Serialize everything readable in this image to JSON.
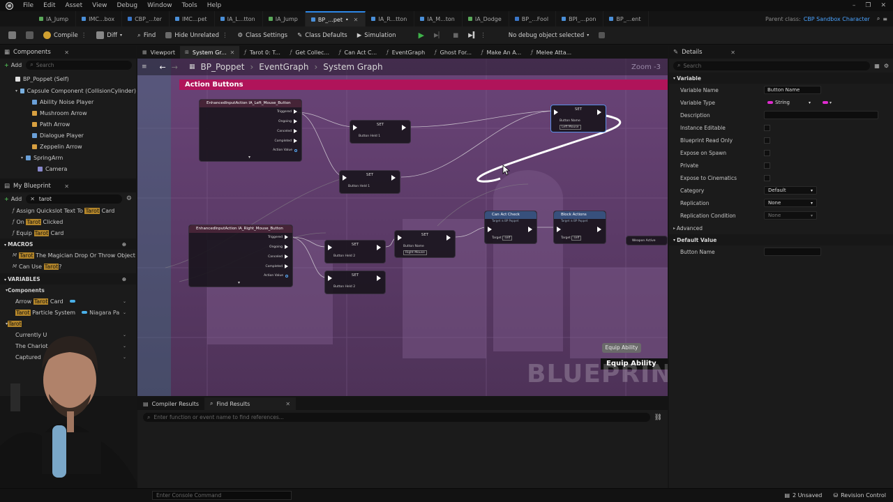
{
  "menu": [
    "File",
    "Edit",
    "Asset",
    "View",
    "Debug",
    "Window",
    "Tools",
    "Help"
  ],
  "tabs": [
    {
      "label": "IA_Jump"
    },
    {
      "label": "IMC...box"
    },
    {
      "label": "CBP_...ter"
    },
    {
      "label": "IMC...pet"
    },
    {
      "label": "IA_L...tton"
    },
    {
      "label": "IA_Jump"
    },
    {
      "label": "BP_...pet",
      "active": true,
      "dirty": "•"
    },
    {
      "label": "IA_R...tton"
    },
    {
      "label": "IA_M...ton"
    },
    {
      "label": "IA_Dodge"
    },
    {
      "label": "BP_...Fool"
    },
    {
      "label": "BPI_...pon"
    },
    {
      "label": "BP_...ent"
    }
  ],
  "parent_class": {
    "label": "Parent class:",
    "value": "CBP Sandbox Character"
  },
  "toolbar": {
    "compile": "Compile",
    "diff": "Diff",
    "find": "Find",
    "hide_unrelated": "Hide Unrelated",
    "class_settings": "Class Settings",
    "class_defaults": "Class Defaults",
    "simulation": "Simulation",
    "debug_object": "No debug object selected"
  },
  "components": {
    "title": "Components",
    "add": "Add",
    "search_placeholder": "Search",
    "items": [
      "BP_Poppet (Self)",
      "Capsule Component (CollisionCylinder)",
      "Ability Noise Player",
      "Mushroom Arrow",
      "Path Arrow",
      "Dialogue Player",
      "Zeppelin Arrow",
      "SpringArm",
      "Camera"
    ]
  },
  "my_blueprint": {
    "title": "My Blueprint",
    "add": "Add",
    "search_value": "tarot",
    "functions": [
      {
        "pre": "Assign Quickslot Text To ",
        "hl": "Tarot",
        "post": " Card"
      },
      {
        "pre": "On ",
        "hl": "Tarot",
        "post": " Clicked"
      },
      {
        "pre": "Equip ",
        "hl": "Tarot",
        "post": " Card"
      }
    ],
    "macros_label": "MACROS",
    "macros": [
      {
        "pre": "",
        "hl": "Tarot",
        "post": " The Magician Drop Or Throw Object"
      },
      {
        "pre": "Can Use ",
        "hl": "Tarot",
        "post": "?"
      }
    ],
    "variables_label": "VARIABLES",
    "components_label": "Components",
    "var_components": [
      {
        "pre": "Arrow ",
        "hl": "Tarot",
        "post": " Card",
        "type": ""
      },
      {
        "pre": "",
        "hl": "Tarot",
        "post": " Particle System",
        "type": "Niagara Pa"
      }
    ],
    "tarot_group": "Tarot",
    "tarot_vars": [
      "Currently U",
      "The Chariot",
      "Captured"
    ]
  },
  "graph_tabs": [
    {
      "label": "Viewport"
    },
    {
      "label": "System Gr...",
      "active": true
    },
    {
      "label": "Tarot 0: T..."
    },
    {
      "label": "Get Collec..."
    },
    {
      "label": "Can Act C..."
    },
    {
      "label": "EventGraph"
    },
    {
      "label": "Ghost For..."
    },
    {
      "label": "Make An A..."
    },
    {
      "label": "Melee Atta..."
    }
  ],
  "breadcrumb": [
    "BP_Poppet",
    "EventGraph",
    "System Graph"
  ],
  "zoom": "Zoom -3",
  "comment_title": "Action Buttons",
  "nodes": {
    "left_input": {
      "title": "EnhancedInputAction IA_Left_Mouse_Button",
      "pins": [
        "Triggered",
        "Ongoing",
        "Canceled",
        "Completed",
        "Action Value"
      ]
    },
    "right_input": {
      "title": "EnhancedInputAction IA_Right_Mouse_Button",
      "pins": [
        "Triggered",
        "Ongoing",
        "Canceled",
        "Completed",
        "Action Value"
      ]
    },
    "set": "SET",
    "button_held_1": "Button Held 1",
    "button_held_2": "Button Held 2",
    "button_name": "Button Name",
    "left_mouse": "Left Mouse",
    "right_mouse": "Right Mouse",
    "can_act_check": "Can Act Check",
    "can_act_sub": "Target is BP Poppet",
    "block_actions": "Block Actions",
    "block_sub": "Target is BP Poppet",
    "target": "Target",
    "self": "self",
    "weapon_active": "Weapon Active",
    "equip_ability_small": "Equip Ability",
    "equip_ability": "Equip Ability"
  },
  "watermark": "BLUEPRINT",
  "details": {
    "title": "Details",
    "search_placeholder": "Search",
    "section_variable": "Variable",
    "rows": [
      {
        "label": "Variable Name",
        "kind": "input",
        "value": "Button Name"
      },
      {
        "label": "Variable Type",
        "kind": "type",
        "value": "String"
      },
      {
        "label": "Description",
        "kind": "input",
        "value": ""
      },
      {
        "label": "Instance Editable",
        "kind": "check"
      },
      {
        "label": "Blueprint Read Only",
        "kind": "check"
      },
      {
        "label": "Expose on Spawn",
        "kind": "check"
      },
      {
        "label": "Private",
        "kind": "check"
      },
      {
        "label": "Expose to Cinematics",
        "kind": "check"
      },
      {
        "label": "Category",
        "kind": "combo",
        "value": "Default"
      },
      {
        "label": "Replication",
        "kind": "combo",
        "value": "None"
      },
      {
        "label": "Replication Condition",
        "kind": "combo",
        "value": "None"
      }
    ],
    "advanced": "Advanced",
    "section_default": "Default Value",
    "default_row": {
      "label": "Button Name",
      "value": ""
    }
  },
  "bottom": {
    "compiler_results": "Compiler Results",
    "find_results": "Find Results",
    "find_placeholder": "Enter function or event name to find references..."
  },
  "status": {
    "console_placeholder": "Enter Console Command",
    "unsaved": "2 Unsaved",
    "revision": "Revision Control"
  },
  "colors": {
    "accent": "#2d88e8",
    "graph_bg": "#5a3a66",
    "comment": "#b0145a",
    "string_pin": "#e02bd0",
    "play": "#3fb24a"
  }
}
